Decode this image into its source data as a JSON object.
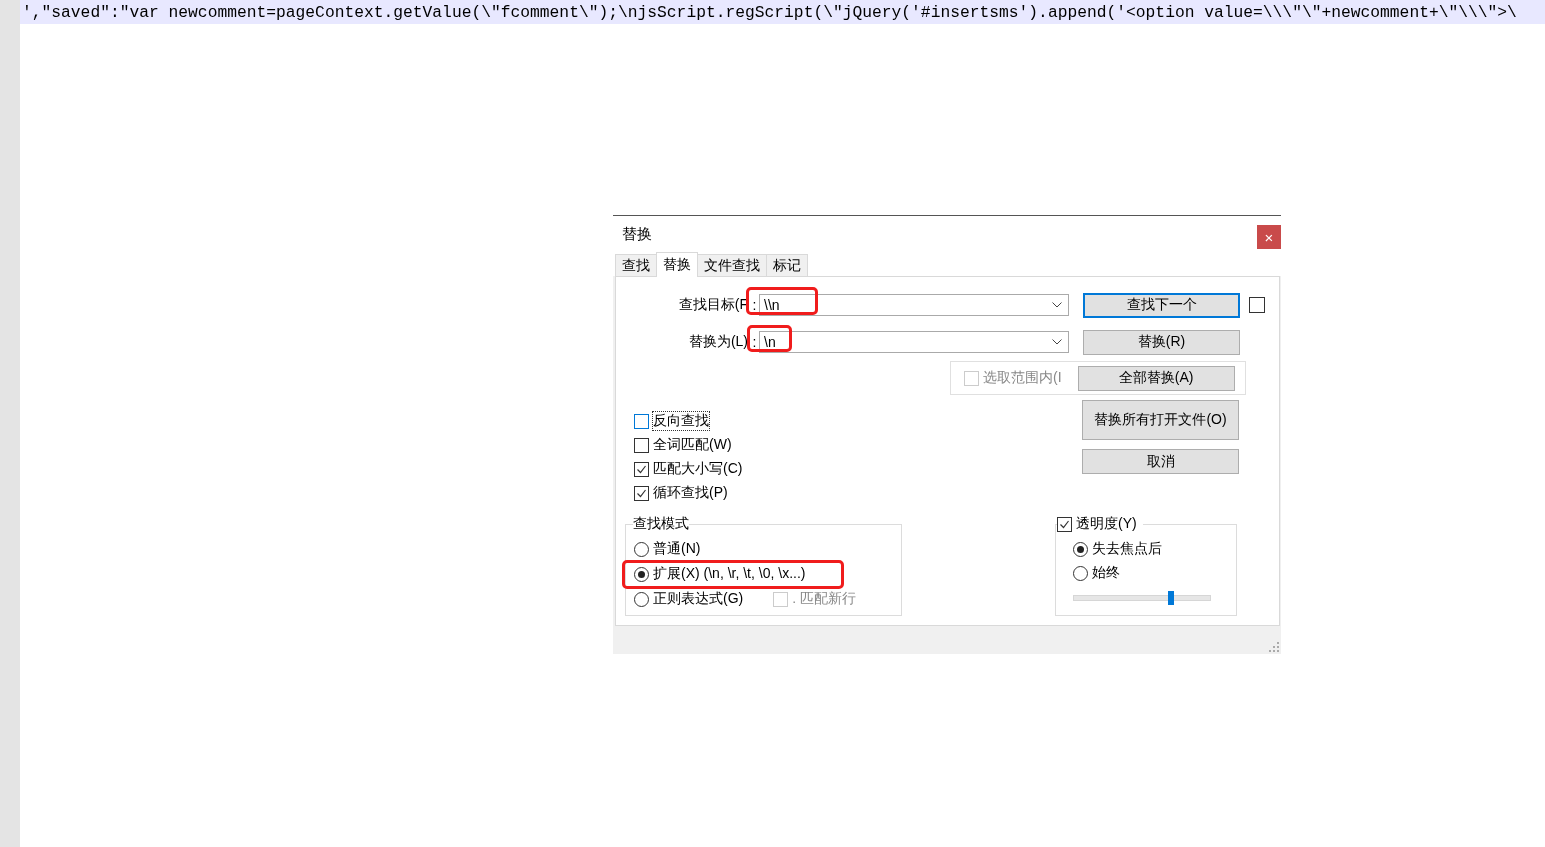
{
  "editor": {
    "line": "',\"saved\":\"var newcomment=pageContext.getValue(\\\"fcomment\\\");\\njsScript.regScript(\\\"jQuery('#insertsms').append('<option value=\\\\\\\"\\\"+newcomment+\\\"\\\\\\\">\\"
  },
  "dialog": {
    "title": "替换",
    "close": "×",
    "tabs": [
      {
        "label": "查找",
        "selected": false
      },
      {
        "label": "替换",
        "selected": true
      },
      {
        "label": "文件查找",
        "selected": false
      },
      {
        "label": "标记",
        "selected": false
      }
    ],
    "find": {
      "label": "查找目标(F",
      "colon": ":",
      "value": "\\\\n",
      "highlighted": true
    },
    "replace": {
      "label": "替换为(L)",
      "colon": ":",
      "value": "\\n",
      "highlighted": true
    },
    "find_next_button": {
      "label": "查找下一个",
      "default": true
    },
    "side_checkbox": {
      "checked": false
    },
    "replace_button": {
      "label": "替换(R)"
    },
    "in_selection": {
      "label": "选取范围内(I",
      "checked": false,
      "disabled": true
    },
    "replace_all_button": {
      "label": "全部替换(A)"
    },
    "replace_all_open_button": {
      "label": "替换所有打开文件(O)"
    },
    "cancel_button": {
      "label": "取消"
    },
    "options": [
      {
        "label": "反向查找",
        "checked": false,
        "focused": true
      },
      {
        "label": "全词匹配(W)",
        "checked": false,
        "focused": false
      },
      {
        "label": "匹配大小写(C)",
        "checked": true,
        "focused": false
      },
      {
        "label": "循环查找(P)",
        "checked": true,
        "focused": false
      }
    ],
    "search_mode": {
      "title": "查找模式",
      "modes": [
        {
          "label": "普通(N)",
          "selected": false,
          "highlighted": false
        },
        {
          "label": "扩展(X) (\\n, \\r, \\t, \\0, \\x...)",
          "selected": true,
          "highlighted": true
        },
        {
          "label": "正则表达式(G)",
          "selected": false,
          "highlighted": false
        }
      ],
      "dot_newline": {
        "label": ". 匹配新行",
        "checked": false,
        "disabled": true
      }
    },
    "transparency": {
      "label": "透明度(Y)",
      "checked": true,
      "modes": [
        {
          "label": "失去焦点后",
          "selected": true
        },
        {
          "label": "始终",
          "selected": false
        }
      ],
      "level": 0.71
    }
  }
}
